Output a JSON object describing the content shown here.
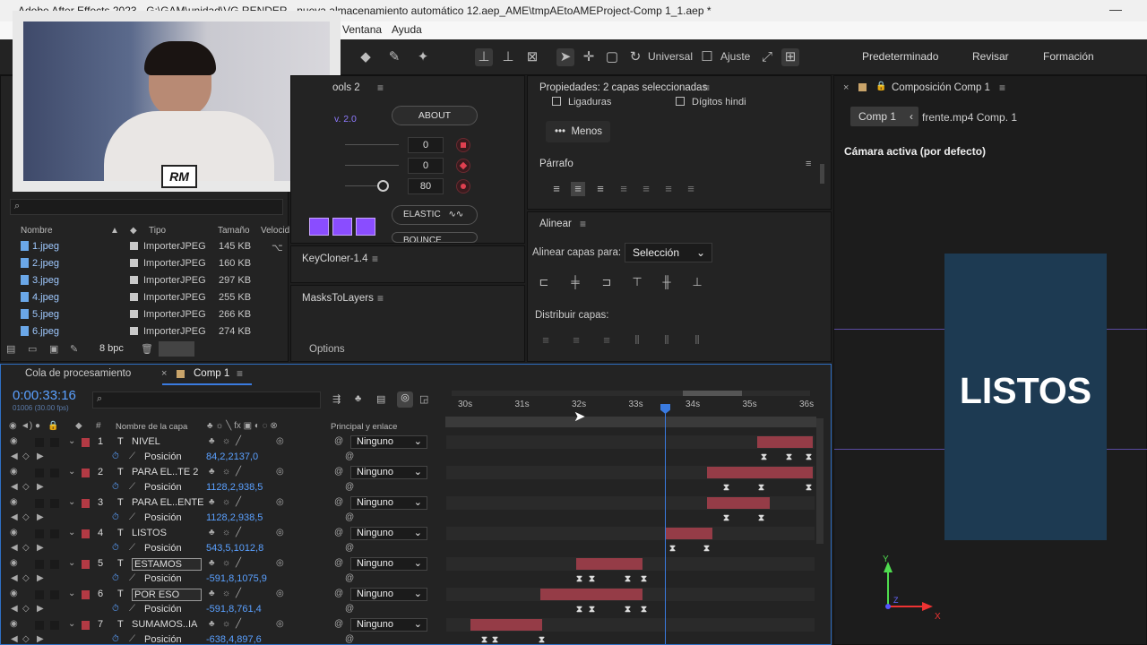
{
  "window": {
    "title": "Adobe After Effects 2023 - G:\\GAM\\unidad\\VG RENDER - nueva almacenamiento automático 12.aep_AME\\tmpAEtoAMEProject-Comp 1_1.aep *"
  },
  "menu": {
    "window_label": "Ventana",
    "help_label": "Ayuda"
  },
  "toolbar": {
    "universal_label": "Universal",
    "ajuste_label": "Ajuste",
    "workspaces": [
      "Predeterminado",
      "Revisar",
      "Formación"
    ]
  },
  "webcam": {
    "logo_text": "RM"
  },
  "project": {
    "search_placeholder": "",
    "columns": [
      "Nombre",
      "Tipo",
      "Tamaño",
      "Velocid"
    ],
    "items": [
      {
        "name": "1.jpeg",
        "type": "ImporterJPEG",
        "size": "145 KB"
      },
      {
        "name": "2.jpeg",
        "type": "ImporterJPEG",
        "size": "160 KB"
      },
      {
        "name": "3.jpeg",
        "type": "ImporterJPEG",
        "size": "297 KB"
      },
      {
        "name": "4.jpeg",
        "type": "ImporterJPEG",
        "size": "255 KB"
      },
      {
        "name": "5.jpeg",
        "type": "ImporterJPEG",
        "size": "266 KB"
      },
      {
        "name": "6.jpeg",
        "type": "ImporterJPEG",
        "size": "274 KB"
      }
    ],
    "bpc_label": "8 bpc"
  },
  "tools_panel": {
    "title": "ools 2",
    "version": "v. 2.0",
    "about_label": "ABOUT",
    "values": [
      "0",
      "0",
      "80"
    ],
    "elastic_label": "ELASTIC",
    "bounce_label": "BOUNCE"
  },
  "keycloner": {
    "title": "KeyCloner-1.4"
  },
  "maskstolayers": {
    "title": "MasksToLayers",
    "options_label": "Options"
  },
  "properties": {
    "title": "Propiedades: 2 capas seleccionadas",
    "ligaduras_label": "Ligaduras",
    "digitos_label": "Dígitos hindi",
    "menos_label": "Menos",
    "parrafo_label": "Párrafo"
  },
  "align": {
    "title": "Alinear",
    "align_to_label": "Alinear capas para:",
    "align_to_value": "Selección",
    "distribute_label": "Distribuir capas:"
  },
  "composition": {
    "title": "Composición Comp 1",
    "tab_label": "Comp 1",
    "breadcrumb_next": "frente.mp4 Comp. 1",
    "camera_label": "Cámara activa (por defecto)",
    "preview_text": "LISTOS",
    "bg_color": "#1d3a52",
    "axis_labels": [
      "Y",
      "Z",
      "X"
    ]
  },
  "timeline": {
    "tab_queue": "Cola de procesamiento",
    "tab_comp": "Comp 1",
    "timecode": "0:00:33:16",
    "frame_info": "01006 (30.00 fps)",
    "search_placeholder": "",
    "layer_name_header": "Nombre de la capa",
    "parent_header": "Principal y enlace",
    "ruler_ticks": [
      "30s",
      "31s",
      "32s",
      "33s",
      "34s",
      "35s",
      "36s"
    ],
    "parent_value": "Ninguno",
    "position_label": "Posición",
    "layers": [
      {
        "num": "1",
        "name": "NIVEL",
        "pos": "84,2,2137,0"
      },
      {
        "num": "2",
        "name": "PARA EL..TE 2",
        "pos": "1128,2,938,5"
      },
      {
        "num": "3",
        "name": "PARA EL..ENTE",
        "pos": "1128,2,938,5"
      },
      {
        "num": "4",
        "name": "LISTOS",
        "pos": "543,5,1012,8"
      },
      {
        "num": "5",
        "name": "ESTAMOS",
        "pos": "-591,8,1075,9"
      },
      {
        "num": "6",
        "name": "POR ESO",
        "pos": "-591,8,761,4"
      },
      {
        "num": "7",
        "name": "SUMAMOS..IA",
        "pos": "-638,4,897,6"
      }
    ]
  }
}
